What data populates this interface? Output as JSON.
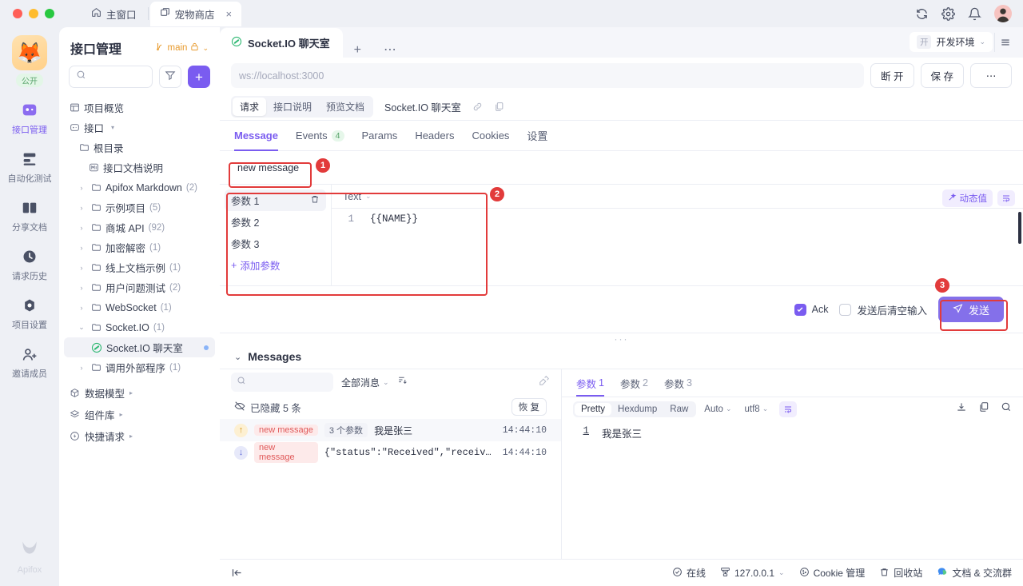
{
  "titlebar": {
    "tabs": [
      {
        "label": "主窗口",
        "icon": "home-icon",
        "active": false,
        "closable": false
      },
      {
        "label": "宠物商店",
        "icon": "window-icon",
        "active": true,
        "closable": true
      }
    ],
    "actions": [
      "sync-icon",
      "gear-icon",
      "bell-icon",
      "avatar"
    ]
  },
  "rail": {
    "workspace": {
      "emoji": "🦊",
      "badge": "公开"
    },
    "items": [
      {
        "label": "接口管理",
        "icon": "api-icon",
        "active": true
      },
      {
        "label": "自动化测试",
        "icon": "automation-icon",
        "active": false
      },
      {
        "label": "分享文档",
        "icon": "docs-icon",
        "active": false
      },
      {
        "label": "请求历史",
        "icon": "clock-icon",
        "active": false
      },
      {
        "label": "项目设置",
        "icon": "settings-icon",
        "active": false
      },
      {
        "label": "邀请成员",
        "icon": "invite-user-icon",
        "active": false
      }
    ],
    "brand": "Apifox"
  },
  "sidebar": {
    "title": "接口管理",
    "branch": "main",
    "search_placeholder": "",
    "tree": [
      {
        "label": "项目概览",
        "icon": "overview-icon",
        "indent": 0,
        "caret": "",
        "count": ""
      },
      {
        "label": "接口",
        "icon": "api-icon",
        "indent": 0,
        "caret": "",
        "count": "",
        "menu": true
      },
      {
        "label": "根目录",
        "icon": "root-folder-icon",
        "indent": 1,
        "caret": "",
        "count": ""
      },
      {
        "label": "接口文档说明",
        "icon": "markdown-icon",
        "indent": 2,
        "caret": "",
        "count": ""
      },
      {
        "label": "Apifox Markdown",
        "icon": "folder-icon",
        "indent": 2,
        "caret": "›",
        "count": "(2)"
      },
      {
        "label": "示例项目",
        "icon": "folder-icon",
        "indent": 2,
        "caret": "›",
        "count": "(5)"
      },
      {
        "label": "商城 API",
        "icon": "folder-icon",
        "indent": 2,
        "caret": "›",
        "count": "(92)"
      },
      {
        "label": "加密解密",
        "icon": "folder-icon",
        "indent": 2,
        "caret": "›",
        "count": "(1)"
      },
      {
        "label": "线上文档示例",
        "icon": "folder-icon",
        "indent": 2,
        "caret": "›",
        "count": "(1)"
      },
      {
        "label": "用户问题测试",
        "icon": "folder-icon",
        "indent": 2,
        "caret": "›",
        "count": "(2)"
      },
      {
        "label": "WebSocket",
        "icon": "folder-icon",
        "indent": 2,
        "caret": "›",
        "count": "(1)"
      },
      {
        "label": "Socket.IO",
        "icon": "folder-open-icon",
        "indent": 2,
        "caret": "⌄",
        "count": "(1)"
      },
      {
        "label": "Socket.IO 聊天室",
        "icon": "socketio-icon",
        "indent": 3,
        "caret": "",
        "count": "",
        "selected": true,
        "dot": true
      },
      {
        "label": "调用外部程序",
        "icon": "folder-icon",
        "indent": 2,
        "caret": "›",
        "count": "(1)"
      }
    ],
    "groups": [
      {
        "label": "数据模型",
        "icon": "model-icon"
      },
      {
        "label": "组件库",
        "icon": "components-icon"
      },
      {
        "label": "快捷请求",
        "icon": "quick-request-icon"
      }
    ]
  },
  "main": {
    "tab": {
      "label": "Socket.IO 聊天室",
      "icon": "socketio-icon"
    },
    "tab_add": "+",
    "tab_more": "⋯",
    "environment": {
      "tag": "开",
      "name": "开发环境"
    },
    "url_placeholder": "ws://localhost:3000",
    "buttons": {
      "disconnect": "断 开",
      "save": "保 存",
      "more": "⋯"
    },
    "subtabs": [
      {
        "label": "请求",
        "active": true
      },
      {
        "label": "接口说明",
        "active": false
      },
      {
        "label": "预览文档",
        "active": false
      }
    ],
    "sub_name": "Socket.IO 聊天室",
    "tabs": [
      {
        "label": "Message",
        "active": true,
        "badge": ""
      },
      {
        "label": "Events",
        "active": false,
        "badge": "4"
      },
      {
        "label": "Params",
        "active": false,
        "badge": ""
      },
      {
        "label": "Headers",
        "active": false,
        "badge": ""
      },
      {
        "label": "Cookies",
        "active": false,
        "badge": ""
      },
      {
        "label": "设置",
        "active": false,
        "badge": ""
      }
    ],
    "event_name": "new message",
    "params": {
      "items": [
        {
          "label": "参数 1",
          "active": true
        },
        {
          "label": "参数 2",
          "active": false
        },
        {
          "label": "参数 3",
          "active": false
        }
      ],
      "add_label": "添加参数",
      "type": "Text",
      "code_line_no": "1",
      "code_text": "{{NAME}}",
      "dynamic_label": "动态值"
    },
    "send_row": {
      "ack_label": "Ack",
      "ack_checked": true,
      "clear_label": "发送后清空输入",
      "clear_checked": false,
      "send_label": "发送"
    }
  },
  "messages": {
    "title": "Messages",
    "search_placeholder": "",
    "filter": "全部消息",
    "hidden_text": "已隐藏 5 条",
    "restore_label": "恢 复",
    "rows": [
      {
        "dir": "up",
        "event": "new message",
        "params": "3 个参数",
        "text": "我是张三",
        "time": "14:44:10",
        "mono": false,
        "highlight": true
      },
      {
        "dir": "down",
        "event": "new message",
        "params": "",
        "text": "{\"status\":\"Received\",\"receive…",
        "time": "14:44:10",
        "mono": true,
        "highlight": false
      }
    ],
    "param_tabs": [
      {
        "label": "参数",
        "n": "1",
        "active": true
      },
      {
        "label": "参数",
        "n": "2",
        "active": false
      },
      {
        "label": "参数",
        "n": "3",
        "active": false
      }
    ],
    "format": {
      "modes": [
        {
          "label": "Pretty",
          "active": true
        },
        {
          "label": "Hexdump",
          "active": false
        },
        {
          "label": "Raw",
          "active": false
        }
      ],
      "auto": "Auto",
      "encoding": "utf8"
    },
    "detail_line_no": "1",
    "detail_text": "我是张三"
  },
  "statusbar": {
    "collapse_icon": "collapse-left-icon",
    "items": [
      {
        "label": "在线",
        "icon": "online-icon"
      },
      {
        "label": "127.0.0.1",
        "icon": "network-icon",
        "caret": true
      },
      {
        "label": "Cookie 管理",
        "icon": "cookie-icon"
      },
      {
        "label": "回收站",
        "icon": "trash-icon"
      },
      {
        "label": "文档 & 交流群",
        "icon": "chat-icon"
      }
    ]
  },
  "annotations": [
    {
      "num": "1"
    },
    {
      "num": "2"
    },
    {
      "num": "3"
    }
  ],
  "colors": {
    "accent": "#7a5cf0",
    "annotation": "#e23b3b",
    "send_button": "#8470ea"
  }
}
